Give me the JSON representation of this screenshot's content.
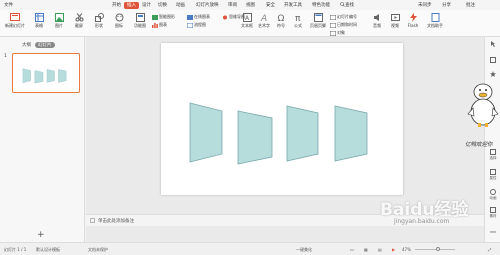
{
  "menubar": {
    "items": [
      "文件",
      "开始",
      "插入",
      "设计",
      "切换",
      "动画",
      "幻灯片放映",
      "审阅",
      "视图",
      "安全",
      "开发工具",
      "特色功能",
      "查找"
    ],
    "active": "插入",
    "right": [
      "未同步",
      "分享",
      "批注"
    ]
  },
  "ribbon": {
    "new_slide": "新建幻灯片",
    "table": "表格",
    "picture": "图片",
    "screenshot": "截屏",
    "shape": "形状",
    "icon": "图标",
    "function_chart": "功能图",
    "smartart": "智能图形",
    "chart": "图表",
    "online_chart": "在线图表",
    "flowchart": "流程图",
    "mindmap": "思维导图",
    "textbox": "文本框",
    "art": "艺术字",
    "symbol": "符号",
    "formula": "公式",
    "header_footer": "页眉页脚",
    "slide_no": "幻灯片编号",
    "datetime": "日期和时间",
    "object": "对象",
    "audio": "音频",
    "video": "视频",
    "flash": "Flash",
    "doc_share": "文档助手"
  },
  "sidebar": {
    "tab_outline": "大纲",
    "tab_slides": "幻灯片",
    "slide_number": "1",
    "add": "+"
  },
  "notes": {
    "placeholder": "单击此处添加备注"
  },
  "statusbar": {
    "slide_count": "幻灯片 1 / 1",
    "theme": "默认设计模板",
    "doc_protect": "文档未保护",
    "notes_toggle": "一键美化",
    "zoom": "47%"
  },
  "rightbar": [
    "选择",
    "属性",
    "动画",
    "素材",
    "翻译",
    "帮助",
    "更多"
  ],
  "watermark": {
    "brand": "Baidu经验",
    "url": "jingyan.baidu.com"
  },
  "side_decoration_text": "亿鸭欢迎你",
  "colors": {
    "accent": "#e0533b",
    "shape_fill": "#b6dcdc",
    "shape_stroke": "#7aa8ad"
  }
}
